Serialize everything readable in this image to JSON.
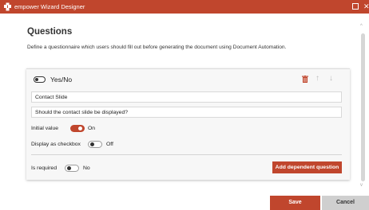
{
  "window": {
    "title": "empower Wizard Designer",
    "accent_color": "#c0462d",
    "icons": {
      "app": "puzzle-icon",
      "maximize": "maximize-icon",
      "close": "close-icon"
    },
    "close_glyph": "✕"
  },
  "page": {
    "heading": "Questions",
    "description": "Define a questionnaire which users should fill out before generating the document using Document Automation."
  },
  "question_card": {
    "type_label": "Yes/No",
    "type_toggle_state": "off",
    "icons": {
      "delete": "trash-icon",
      "move_up": "arrow-up-icon",
      "move_down": "arrow-down-icon"
    },
    "up_glyph": "↑",
    "down_glyph": "↓",
    "title_value": "Contact Slide",
    "question_value": "Should the contact slide be displayed?",
    "initial_value": {
      "label": "Initial value",
      "state_text": "On",
      "on": true
    },
    "display_as_checkbox": {
      "label": "Display as checkbox",
      "state_text": "Off",
      "on": false
    },
    "is_required": {
      "label": "Is required",
      "state_text": "No",
      "on": false
    },
    "add_dependent_label": "Add dependent question"
  },
  "footer": {
    "save_label": "Save",
    "cancel_label": "Cancel"
  },
  "scrollbar": {
    "up_glyph": "^",
    "down_glyph": "v"
  }
}
